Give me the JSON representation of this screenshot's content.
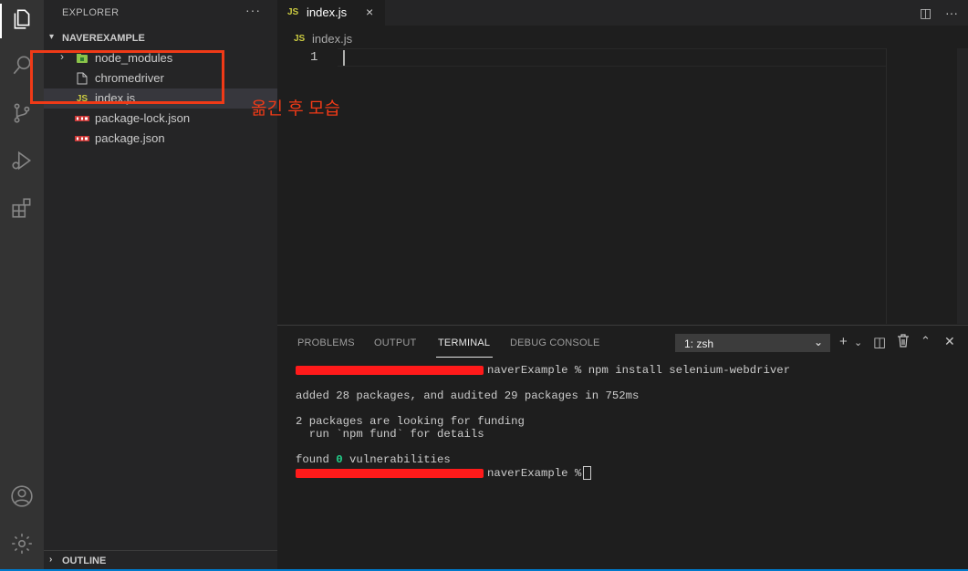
{
  "sidebar": {
    "title": "EXPLORER",
    "more": "···",
    "folder": "NAVEREXAMPLE",
    "items": [
      {
        "label": "node_modules",
        "icon": "node-modules-folder-icon"
      },
      {
        "label": "chromedriver",
        "icon": "file-icon"
      },
      {
        "label": "index.js",
        "icon": "js-icon",
        "badge": "JS"
      },
      {
        "label": "package-lock.json",
        "icon": "npm-icon"
      },
      {
        "label": "package.json",
        "icon": "npm-icon"
      }
    ],
    "outline": "OUTLINE"
  },
  "annotation": {
    "text": "옮긴 후 모습",
    "color": "#f03a17"
  },
  "editor": {
    "tab_badge": "JS",
    "tab_label": "index.js",
    "tab_close": "×",
    "breadcrumb_badge": "JS",
    "breadcrumb_label": "index.js",
    "line_number": "1"
  },
  "panel": {
    "tabs": [
      "PROBLEMS",
      "OUTPUT",
      "TERMINAL",
      "DEBUG CONSOLE"
    ],
    "active_tab": "TERMINAL",
    "terminal_select": "1: zsh",
    "terminal": {
      "line1_prompt": "naverExample % npm install selenium-webdriver",
      "line2": "added 28 packages, and audited 29 packages in 752ms",
      "line3": "2 packages are looking for funding",
      "line4": "  run `npm fund` for details",
      "line5_pre": "found ",
      "line5_num": "0",
      "line5_post": " vulnerabilities",
      "line6_prompt": "naverExample %"
    }
  },
  "colors": {
    "accent": "#007acc",
    "annotation": "#f03a17",
    "js": "#cbcb41"
  }
}
